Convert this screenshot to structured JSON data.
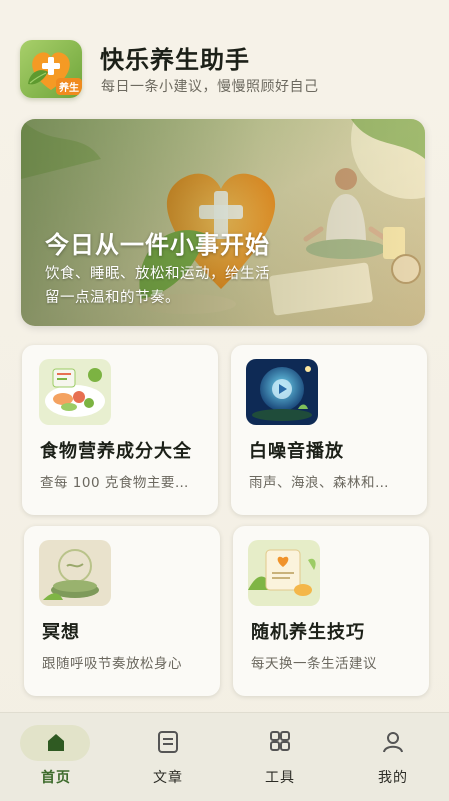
{
  "app": {
    "title": "快乐养生助手",
    "subtitle": "每日一条小建议，慢慢照顾好自己",
    "logo_tag": "养生"
  },
  "hero": {
    "title": "今日从一件小事开始",
    "text_line1": "饮食、睡眠、放松和运动，给生活",
    "text_line2": "留一点温和的节奏。"
  },
  "cards": [
    {
      "title": "食物营养成分大全",
      "desc": "查每 100 克食物主要…",
      "icon": "food-plate-icon"
    },
    {
      "title": "白噪音播放",
      "desc": "雨声、海浪、森林和…",
      "icon": "play-icon"
    },
    {
      "title": "冥想",
      "desc": "跟随呼吸节奏放松身心",
      "icon": "meditation-cushion-icon"
    },
    {
      "title": "随机养生技巧",
      "desc": "每天换一条生活建议",
      "icon": "tips-card-icon"
    }
  ],
  "tabs": [
    {
      "label": "首页",
      "icon": "home-icon",
      "active": true
    },
    {
      "label": "文章",
      "icon": "article-icon",
      "active": false
    },
    {
      "label": "工具",
      "icon": "grid-icon",
      "active": false
    },
    {
      "label": "我的",
      "icon": "user-icon",
      "active": false
    }
  ],
  "colors": {
    "accent": "#3d6b2c",
    "background": "#f4f0e6",
    "logo_orange": "#f08b1f",
    "logo_green": "#7fb545"
  }
}
